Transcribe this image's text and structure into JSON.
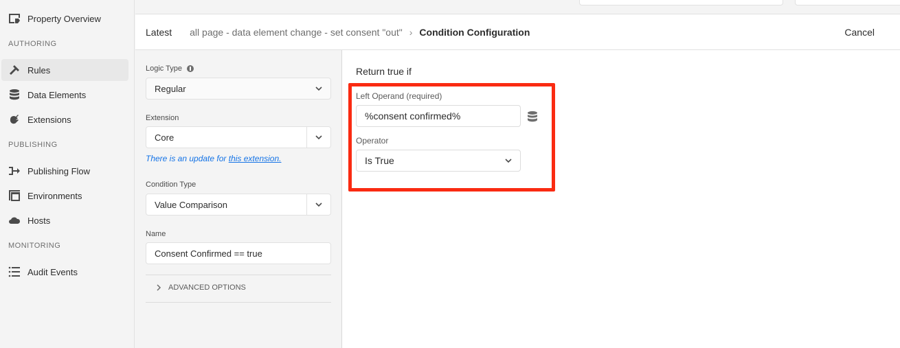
{
  "sidebar": {
    "items": [
      {
        "label": "Property Overview",
        "icon": "property-overview-icon"
      },
      {
        "label": "Rules",
        "icon": "rules-icon",
        "active": true
      },
      {
        "label": "Data Elements",
        "icon": "data-elements-icon"
      },
      {
        "label": "Extensions",
        "icon": "extensions-icon"
      },
      {
        "label": "Publishing Flow",
        "icon": "publishing-flow-icon"
      },
      {
        "label": "Environments",
        "icon": "environments-icon"
      },
      {
        "label": "Hosts",
        "icon": "hosts-icon"
      },
      {
        "label": "Audit Events",
        "icon": "audit-events-icon"
      }
    ],
    "sections": [
      "AUTHORING",
      "PUBLISHING",
      "MONITORING"
    ]
  },
  "header": {
    "latest": "Latest",
    "rule_name": "all page - data element change - set consent \"out\"",
    "separator": "›",
    "current": "Condition Configuration",
    "cancel": "Cancel"
  },
  "config": {
    "logic_type_label": "Logic Type",
    "logic_type_value": "Regular",
    "extension_label": "Extension",
    "extension_value": "Core",
    "update_note": "There is an update for ",
    "update_link": "this extension.",
    "condition_type_label": "Condition Type",
    "condition_type_value": "Value Comparison",
    "name_label": "Name",
    "name_value": "Consent Confirmed == true",
    "advanced_options": "ADVANCED OPTIONS"
  },
  "main": {
    "return_true_if": "Return true if",
    "left_operand_label": "Left Operand (required)",
    "left_operand_value": "%consent confirmed%",
    "operator_label": "Operator",
    "operator_value": "Is True",
    "highlight_color": "#fa2b12"
  }
}
